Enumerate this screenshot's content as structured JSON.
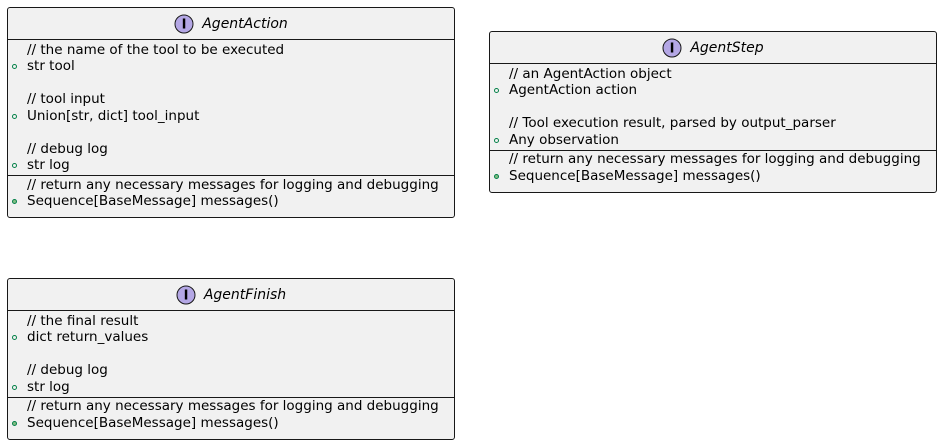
{
  "diagram": {
    "colors": {
      "box_fill": "#f1f1f1",
      "box_border": "#181818",
      "interface_icon_fill": "#b4a7e5",
      "visibility_public": "#038048",
      "visibility_method_fill": "#84be84"
    },
    "classes": [
      {
        "stereotype_icon": "interface-icon",
        "stereotype_letter": "I",
        "name": "AgentAction",
        "fields": [
          {
            "type": "comment",
            "text": "// the name of the tool to be executed"
          },
          {
            "type": "field",
            "text": "str tool"
          },
          {
            "type": "blank",
            "text": ""
          },
          {
            "type": "comment",
            "text": "// tool input"
          },
          {
            "type": "field",
            "text": "Union[str, dict] tool_input"
          },
          {
            "type": "blank",
            "text": ""
          },
          {
            "type": "comment",
            "text": "// debug log"
          },
          {
            "type": "field",
            "text": "str log"
          }
        ],
        "methods": [
          {
            "type": "comment",
            "text": "// return any necessary messages for logging and debugging"
          },
          {
            "type": "method",
            "text": "Sequence[BaseMessage] messages()"
          }
        ]
      },
      {
        "stereotype_icon": "interface-icon",
        "stereotype_letter": "I",
        "name": "AgentStep",
        "fields": [
          {
            "type": "comment",
            "text": "// an AgentAction object"
          },
          {
            "type": "field",
            "text": "AgentAction action"
          },
          {
            "type": "blank",
            "text": ""
          },
          {
            "type": "comment",
            "text": "// Tool execution result, parsed by output_parser"
          },
          {
            "type": "field",
            "text": "Any observation"
          }
        ],
        "methods": [
          {
            "type": "comment",
            "text": "// return any necessary messages for logging and debugging"
          },
          {
            "type": "method",
            "text": "Sequence[BaseMessage] messages()"
          }
        ]
      },
      {
        "stereotype_icon": "interface-icon",
        "stereotype_letter": "I",
        "name": "AgentFinish",
        "fields": [
          {
            "type": "comment",
            "text": "// the final result"
          },
          {
            "type": "field",
            "text": "dict return_values"
          },
          {
            "type": "blank",
            "text": ""
          },
          {
            "type": "comment",
            "text": "// debug log"
          },
          {
            "type": "field",
            "text": "str log"
          }
        ],
        "methods": [
          {
            "type": "comment",
            "text": "// return any necessary messages for logging and debugging"
          },
          {
            "type": "method",
            "text": "Sequence[BaseMessage] messages()"
          }
        ]
      }
    ]
  }
}
